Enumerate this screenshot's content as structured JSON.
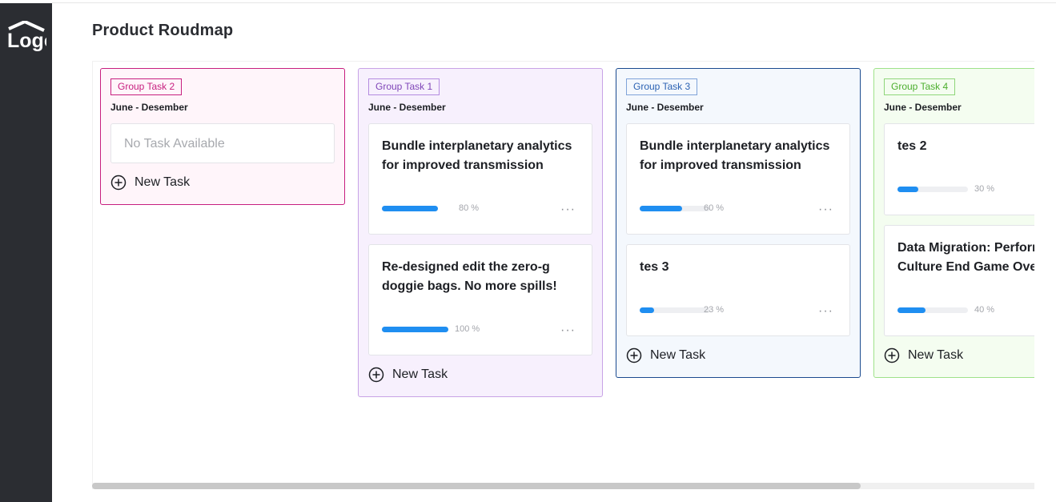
{
  "logo": {
    "text": "Logo",
    "icon": "logo-house-icon"
  },
  "page": {
    "title": "Product Roudmap"
  },
  "columns": [
    {
      "tag": "Group Task 2",
      "date_range": "June - Desember",
      "empty_text": "No Task Available",
      "new_task_label": "New Task",
      "colors": {
        "border": "#c71f7f",
        "background": "#fff5fa",
        "tag": "#c71f7f"
      },
      "tasks": []
    },
    {
      "tag": "Group Task 1",
      "date_range": "June - Desember",
      "new_task_label": "New Task",
      "colors": {
        "border": "#c8a3e6",
        "background": "#f7f0fd",
        "tag": "#7f45b8"
      },
      "tasks": [
        {
          "title": "Bundle interplanetary analytics for improved transmission",
          "progress": 80,
          "progress_label": "80 %",
          "more": "···"
        },
        {
          "title": "Re-designed edit the zero-g doggie bags. No more spills!",
          "progress": 100,
          "progress_label": "100 %",
          "more": "···"
        }
      ]
    },
    {
      "tag": "Group Task 3",
      "date_range": "June - Desember",
      "new_task_label": "New Task",
      "colors": {
        "border": "#1b4a8f",
        "background": "#f4f8fd",
        "tag": "#2b62b3"
      },
      "tasks": [
        {
          "title": "Bundle interplanetary analytics for improved transmission",
          "progress": 60,
          "progress_label": "60 %",
          "more": "···"
        },
        {
          "title": "tes 3",
          "progress": 23,
          "progress_label": "23 %",
          "more": "···"
        }
      ]
    },
    {
      "tag": "Group Task 4",
      "date_range": "June - Desember",
      "new_task_label": "New Task",
      "colors": {
        "border": "#9fe28a",
        "background": "#f4fdf0",
        "tag": "#4cae2e"
      },
      "tasks": [
        {
          "title": "tes 2",
          "progress": 30,
          "progress_label": "30 %"
        },
        {
          "title": "Data Migration: Performance & Culture End Game Overview",
          "progress": 40,
          "progress_label": "40 %"
        }
      ]
    }
  ],
  "colors": {
    "sidebar": "#2b2d32",
    "progress": "#1f8ef1"
  }
}
